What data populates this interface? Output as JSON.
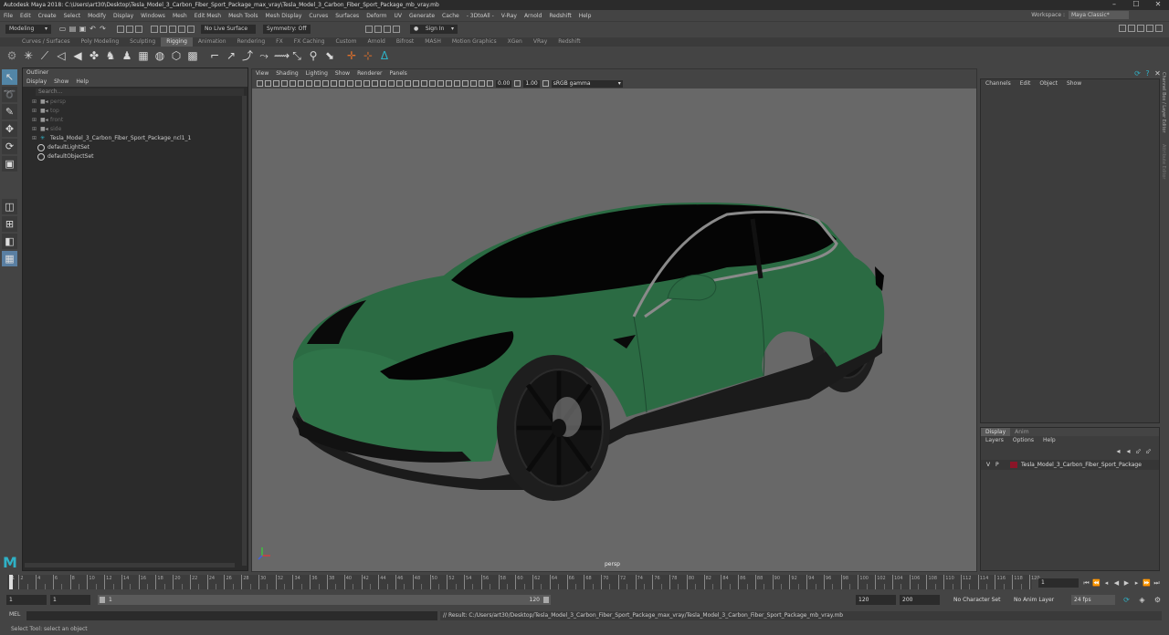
{
  "window": {
    "title": "Autodesk Maya 2018: C:\\Users\\art30\\Desktop\\Tesla_Model_3_Carbon_Fiber_Sport_Package_max_vray\\Tesla_Model_3_Carbon_Fiber_Sport_Package_mb_vray.mb"
  },
  "menubar": {
    "items": [
      "File",
      "Edit",
      "Create",
      "Select",
      "Modify",
      "Display",
      "Windows",
      "Mesh",
      "Edit Mesh",
      "Mesh Tools",
      "Mesh Display",
      "Curves",
      "Surfaces",
      "Deform",
      "UV",
      "Generate",
      "Cache",
      "- 3DtoAll -",
      "V-Ray",
      "Arnold",
      "Redshift",
      "Help"
    ],
    "workspace_label": "Workspace :",
    "workspace_value": "Maya Classic*"
  },
  "statusline": {
    "mode": "Modeling",
    "live_surface": "No Live Surface",
    "symmetry": "Symmetry: Off",
    "sign_in": "Sign In"
  },
  "shelf": {
    "tabs": [
      "Curves / Surfaces",
      "Poly Modeling",
      "Sculpting",
      "Rigging",
      "Animation",
      "Rendering",
      "FX",
      "FX Caching",
      "Custom",
      "Arnold",
      "Bifrost",
      "MASH",
      "Motion Graphics",
      "XGen",
      "VRay",
      "Redshift"
    ],
    "active_tab": "Rigging"
  },
  "outliner": {
    "title": "Outliner",
    "menu": [
      "Display",
      "Show",
      "Help"
    ],
    "search_placeholder": "Search...",
    "items": [
      {
        "label": "persp",
        "type": "camera",
        "dim": true
      },
      {
        "label": "top",
        "type": "camera",
        "dim": true
      },
      {
        "label": "front",
        "type": "camera",
        "dim": true
      },
      {
        "label": "side",
        "type": "camera",
        "dim": true
      },
      {
        "label": "Tesla_Model_3_Carbon_Fiber_Sport_Package_ncl1_1",
        "type": "group",
        "dim": false
      },
      {
        "label": "defaultLightSet",
        "type": "set",
        "dim": false
      },
      {
        "label": "defaultObjectSet",
        "type": "set",
        "dim": false
      }
    ]
  },
  "viewport": {
    "menu": [
      "View",
      "Shading",
      "Lighting",
      "Show",
      "Renderer",
      "Panels"
    ],
    "exposure": "0.00",
    "gamma": "1.00",
    "color_space": "sRGB gamma",
    "camera_label": "persp"
  },
  "channelbox": {
    "menu": [
      "Channels",
      "Edit",
      "Object",
      "Show"
    ],
    "side_tabs": [
      "Channel Box / Layer Editor",
      "Attribute Editor"
    ]
  },
  "layers": {
    "tabs": [
      "Display",
      "Anim"
    ],
    "menu": [
      "Layers",
      "Options",
      "Help"
    ],
    "rows": [
      {
        "v": "V",
        "p": "P",
        "name": "Tesla_Model_3_Carbon_Fiber_Sport_Package",
        "color": "#8a1528"
      }
    ]
  },
  "timeline": {
    "ticks": [
      "1",
      "2",
      "4",
      "6",
      "8",
      "10",
      "12",
      "14",
      "16",
      "18",
      "20",
      "22",
      "24",
      "26",
      "28",
      "30",
      "32",
      "34",
      "36",
      "38",
      "40",
      "42",
      "44",
      "46",
      "48",
      "50",
      "52",
      "54",
      "56",
      "58",
      "60",
      "62",
      "64",
      "66",
      "68",
      "70",
      "72",
      "74",
      "76",
      "78",
      "80",
      "82",
      "84",
      "86",
      "88",
      "90",
      "92",
      "94",
      "96",
      "98",
      "100",
      "102",
      "104",
      "106",
      "108",
      "110",
      "112",
      "114",
      "116",
      "118",
      "120"
    ],
    "current_frame": "1"
  },
  "range": {
    "start": "1",
    "inner_start": "1",
    "slider_start": "1",
    "slider_end": "120",
    "end": "120",
    "anim_end": "200",
    "character_set": "No Character Set",
    "anim_layer": "No Anim Layer",
    "fps": "24 fps"
  },
  "commandline": {
    "mel_label": "MEL",
    "result": "// Result: C:/Users/art30/Desktop/Tesla_Model_3_Carbon_Fiber_Sport_Package_max_vray/Tesla_Model_3_Carbon_Fiber_Sport_Package_mb_vray.mb"
  },
  "helpline": "Select Tool: select an object",
  "colors": {
    "car_body": "#2b6b43",
    "accent": "#5285a6",
    "layer_color": "#8a1528"
  }
}
